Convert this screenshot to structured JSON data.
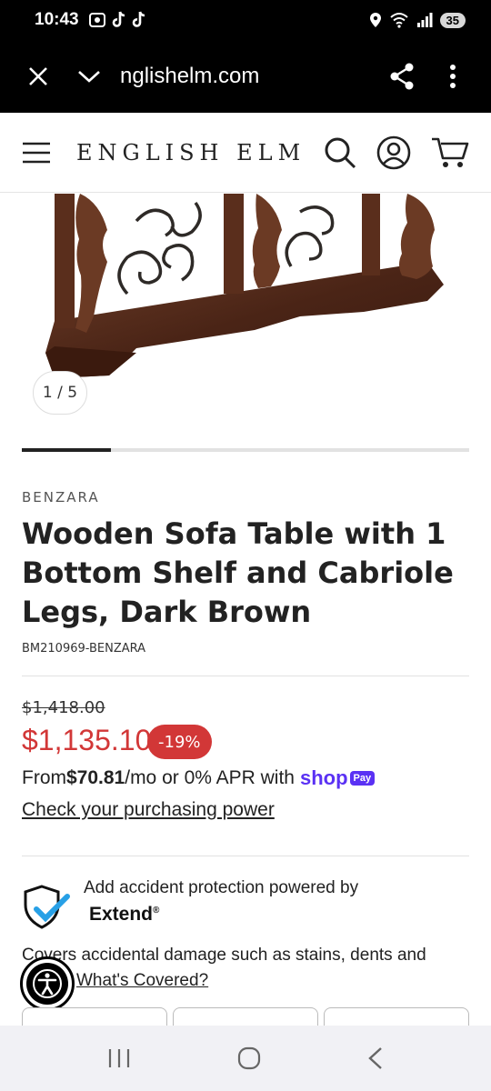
{
  "status": {
    "time": "10:43",
    "battery": "35"
  },
  "browser": {
    "url": "nglishelm.com"
  },
  "site": {
    "brand": "ENGLISH ELM"
  },
  "gallery": {
    "counter": "1 / 5",
    "progress_fraction": 0.2
  },
  "product": {
    "vendor": "BENZARA",
    "title": "Wooden Sofa Table with 1 Bottom Shelf and Cabriole Legs, Dark Brown",
    "sku": "BM210969-BENZARA",
    "compare_price": "$1,418.00",
    "price": "$1,135.10",
    "discount": "-19%"
  },
  "installments": {
    "prefix": "From ",
    "amount": "$70.81",
    "suffix": "/mo or 0% APR with",
    "shop_word": "shop",
    "pay_badge": "Pay",
    "link": "Check your purchasing power"
  },
  "extend": {
    "heading": "Add accident protection powered by",
    "logo": "Extend",
    "logo_mark": "®",
    "covers": "Covers accidental damage such as stains, dents and",
    "link": "What's Covered?"
  },
  "colors": {
    "sale_red": "#d23737",
    "shop_purple": "#5a31f4",
    "extend_blue": "#27a0e6"
  }
}
